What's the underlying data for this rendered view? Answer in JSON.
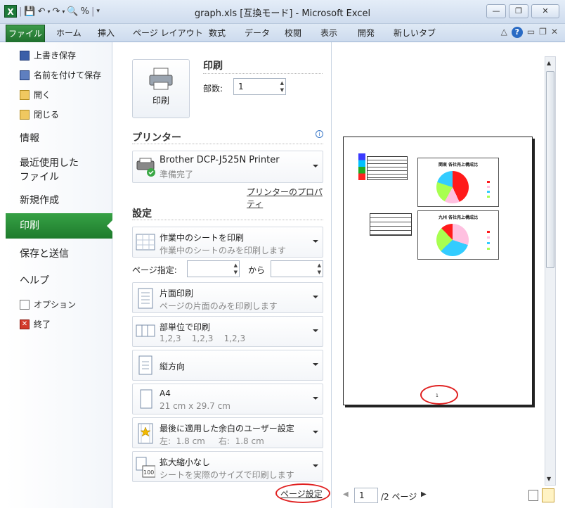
{
  "window": {
    "title": "graph.xls  [互換モード] - Microsoft Excel",
    "app_icon": "X",
    "controls": {
      "minimize": "▭",
      "restore": "▢",
      "close": "✕"
    }
  },
  "ribbon": {
    "file_tab": "ファイル",
    "tabs": [
      "ホーム",
      "挿入",
      "ページ レイアウト",
      "数式",
      "データ",
      "校閲",
      "表示",
      "開発",
      "新しいタブ"
    ]
  },
  "backstage_nav": {
    "save": "上書き保存",
    "save_as": "名前を付けて保存",
    "open": "開く",
    "close": "閉じる",
    "info": "情報",
    "recent_line1": "最近使用した",
    "recent_line2": "ファイル",
    "new": "新規作成",
    "print": "印刷",
    "save_send": "保存と送信",
    "help": "ヘルプ",
    "options": "オプション",
    "exit": "終了"
  },
  "print_panel": {
    "print_button": "印刷",
    "print_heading": "印刷",
    "copies_label": "部数:",
    "copies_value": "1",
    "printer_heading": "プリンター",
    "printer_name": "Brother DCP-J525N Printer",
    "printer_status": "準備完了",
    "printer_properties": "プリンターのプロパティ",
    "settings_heading": "設定",
    "what_to_print": {
      "title": "作業中のシートを印刷",
      "sub": "作業中のシートのみを印刷します"
    },
    "pages_label": "ページ指定:",
    "pages_to": "から",
    "sides": {
      "title": "片面印刷",
      "sub": "ページの片面のみを印刷します"
    },
    "collate": {
      "title": "部単位で印刷",
      "sub": "1,2,3    1,2,3    1,2,3"
    },
    "orientation": {
      "title": "縦方向"
    },
    "paper": {
      "title": "A4",
      "sub": "21 cm x 29.7 cm"
    },
    "margins": {
      "title": "最後に適用した余白のユーザー設定",
      "sub": "左:  1.8 cm     右:  1.8 cm"
    },
    "scaling": {
      "title": "拡大縮小なし",
      "sub": "シートを実際のサイズで印刷します"
    },
    "page_setup_link": "ページ設定"
  },
  "preview": {
    "chart1_title": "関東 各社売上構成比",
    "chart2_title": "九州 各社売上構成比",
    "page_number_mark": "1",
    "current_page": "1",
    "page_total": "/2 ページ",
    "pie_colors": [
      "#ff1a1a",
      "#ffc0e0",
      "#33ccff",
      "#a8ff50"
    ]
  }
}
